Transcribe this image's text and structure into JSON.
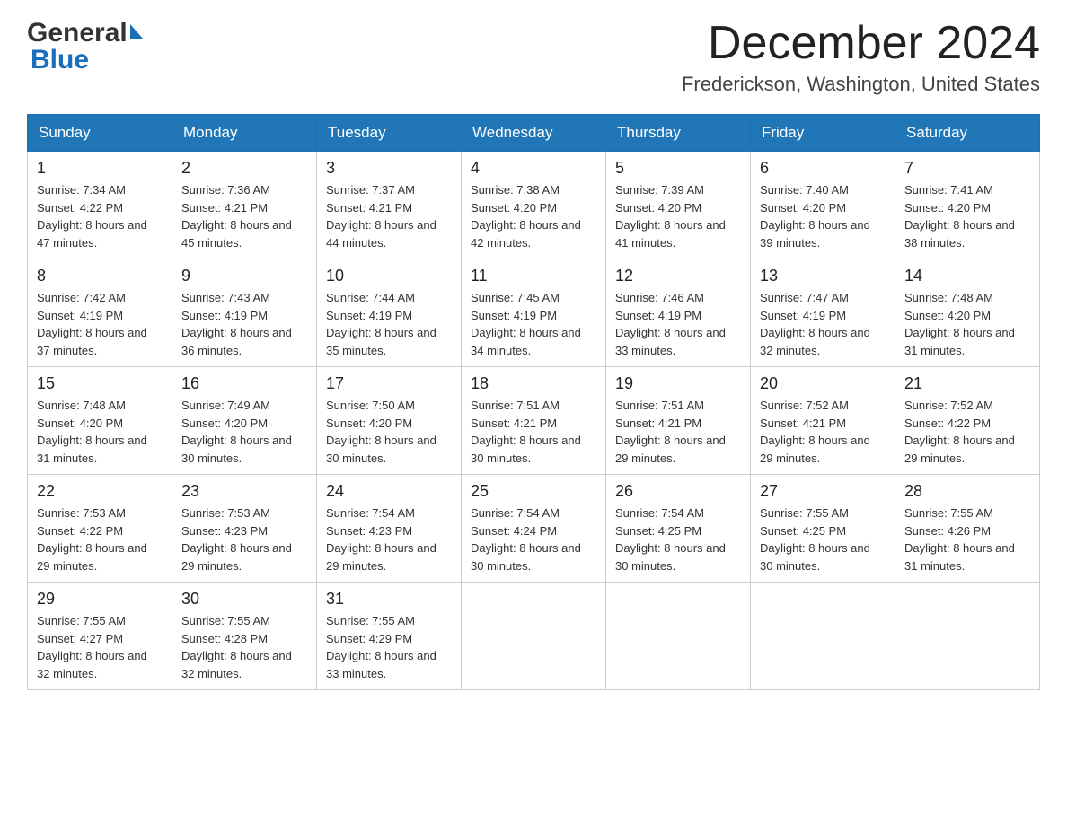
{
  "header": {
    "logo_general": "General",
    "logo_blue": "Blue",
    "month_title": "December 2024",
    "location": "Frederickson, Washington, United States"
  },
  "weekdays": [
    "Sunday",
    "Monday",
    "Tuesday",
    "Wednesday",
    "Thursday",
    "Friday",
    "Saturday"
  ],
  "weeks": [
    [
      {
        "day": "1",
        "sunrise": "7:34 AM",
        "sunset": "4:22 PM",
        "daylight": "8 hours and 47 minutes."
      },
      {
        "day": "2",
        "sunrise": "7:36 AM",
        "sunset": "4:21 PM",
        "daylight": "8 hours and 45 minutes."
      },
      {
        "day": "3",
        "sunrise": "7:37 AM",
        "sunset": "4:21 PM",
        "daylight": "8 hours and 44 minutes."
      },
      {
        "day": "4",
        "sunrise": "7:38 AM",
        "sunset": "4:20 PM",
        "daylight": "8 hours and 42 minutes."
      },
      {
        "day": "5",
        "sunrise": "7:39 AM",
        "sunset": "4:20 PM",
        "daylight": "8 hours and 41 minutes."
      },
      {
        "day": "6",
        "sunrise": "7:40 AM",
        "sunset": "4:20 PM",
        "daylight": "8 hours and 39 minutes."
      },
      {
        "day": "7",
        "sunrise": "7:41 AM",
        "sunset": "4:20 PM",
        "daylight": "8 hours and 38 minutes."
      }
    ],
    [
      {
        "day": "8",
        "sunrise": "7:42 AM",
        "sunset": "4:19 PM",
        "daylight": "8 hours and 37 minutes."
      },
      {
        "day": "9",
        "sunrise": "7:43 AM",
        "sunset": "4:19 PM",
        "daylight": "8 hours and 36 minutes."
      },
      {
        "day": "10",
        "sunrise": "7:44 AM",
        "sunset": "4:19 PM",
        "daylight": "8 hours and 35 minutes."
      },
      {
        "day": "11",
        "sunrise": "7:45 AM",
        "sunset": "4:19 PM",
        "daylight": "8 hours and 34 minutes."
      },
      {
        "day": "12",
        "sunrise": "7:46 AM",
        "sunset": "4:19 PM",
        "daylight": "8 hours and 33 minutes."
      },
      {
        "day": "13",
        "sunrise": "7:47 AM",
        "sunset": "4:19 PM",
        "daylight": "8 hours and 32 minutes."
      },
      {
        "day": "14",
        "sunrise": "7:48 AM",
        "sunset": "4:20 PM",
        "daylight": "8 hours and 31 minutes."
      }
    ],
    [
      {
        "day": "15",
        "sunrise": "7:48 AM",
        "sunset": "4:20 PM",
        "daylight": "8 hours and 31 minutes."
      },
      {
        "day": "16",
        "sunrise": "7:49 AM",
        "sunset": "4:20 PM",
        "daylight": "8 hours and 30 minutes."
      },
      {
        "day": "17",
        "sunrise": "7:50 AM",
        "sunset": "4:20 PM",
        "daylight": "8 hours and 30 minutes."
      },
      {
        "day": "18",
        "sunrise": "7:51 AM",
        "sunset": "4:21 PM",
        "daylight": "8 hours and 30 minutes."
      },
      {
        "day": "19",
        "sunrise": "7:51 AM",
        "sunset": "4:21 PM",
        "daylight": "8 hours and 29 minutes."
      },
      {
        "day": "20",
        "sunrise": "7:52 AM",
        "sunset": "4:21 PM",
        "daylight": "8 hours and 29 minutes."
      },
      {
        "day": "21",
        "sunrise": "7:52 AM",
        "sunset": "4:22 PM",
        "daylight": "8 hours and 29 minutes."
      }
    ],
    [
      {
        "day": "22",
        "sunrise": "7:53 AM",
        "sunset": "4:22 PM",
        "daylight": "8 hours and 29 minutes."
      },
      {
        "day": "23",
        "sunrise": "7:53 AM",
        "sunset": "4:23 PM",
        "daylight": "8 hours and 29 minutes."
      },
      {
        "day": "24",
        "sunrise": "7:54 AM",
        "sunset": "4:23 PM",
        "daylight": "8 hours and 29 minutes."
      },
      {
        "day": "25",
        "sunrise": "7:54 AM",
        "sunset": "4:24 PM",
        "daylight": "8 hours and 30 minutes."
      },
      {
        "day": "26",
        "sunrise": "7:54 AM",
        "sunset": "4:25 PM",
        "daylight": "8 hours and 30 minutes."
      },
      {
        "day": "27",
        "sunrise": "7:55 AM",
        "sunset": "4:25 PM",
        "daylight": "8 hours and 30 minutes."
      },
      {
        "day": "28",
        "sunrise": "7:55 AM",
        "sunset": "4:26 PM",
        "daylight": "8 hours and 31 minutes."
      }
    ],
    [
      {
        "day": "29",
        "sunrise": "7:55 AM",
        "sunset": "4:27 PM",
        "daylight": "8 hours and 32 minutes."
      },
      {
        "day": "30",
        "sunrise": "7:55 AM",
        "sunset": "4:28 PM",
        "daylight": "8 hours and 32 minutes."
      },
      {
        "day": "31",
        "sunrise": "7:55 AM",
        "sunset": "4:29 PM",
        "daylight": "8 hours and 33 minutes."
      },
      null,
      null,
      null,
      null
    ]
  ],
  "labels": {
    "sunrise_prefix": "Sunrise: ",
    "sunset_prefix": "Sunset: ",
    "daylight_prefix": "Daylight: "
  }
}
